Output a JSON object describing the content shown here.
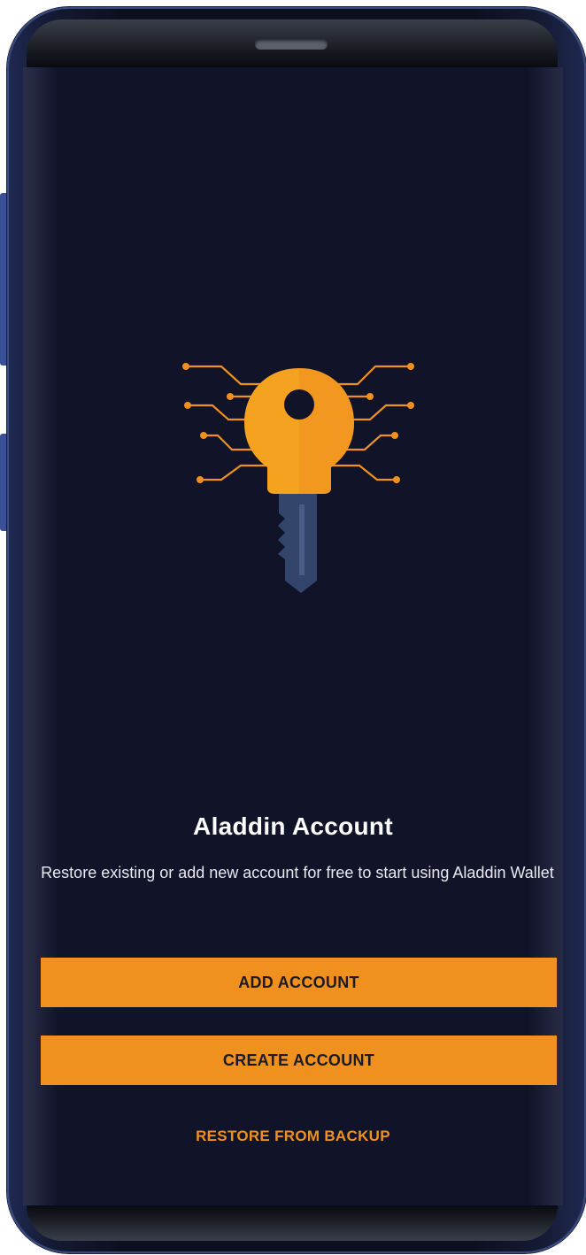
{
  "onboarding": {
    "title": "Aladdin Account",
    "description": "Restore existing or add new account for free to start using Aladdin Wallet",
    "illustration_icon": "digital-key-icon"
  },
  "actions": {
    "add_account_label": "ADD ACCOUNT",
    "create_account_label": "CREATE ACCOUNT",
    "restore_label": "RESTORE FROM BACKUP"
  },
  "colors": {
    "background": "#111329",
    "accent": "#f0901f",
    "key_blade": "#34456b",
    "text_primary": "#ffffff"
  }
}
